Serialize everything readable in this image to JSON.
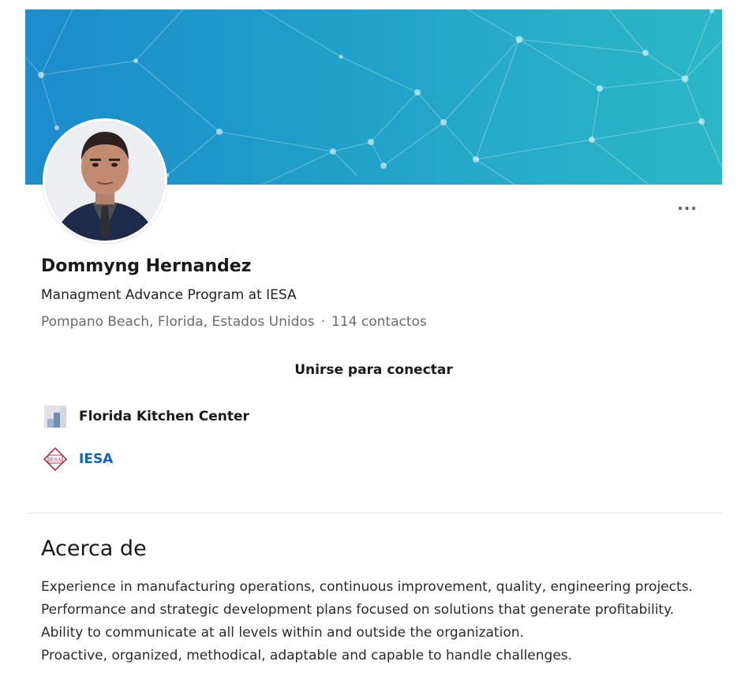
{
  "profile": {
    "name": "Dommyng Hernandez",
    "headline": "Managment Advance Program at IESA",
    "location": "Pompano Beach, Florida, Estados Unidos",
    "separator": "·",
    "connections": "114 contactos",
    "more_label": "···",
    "join_label": "Unirse para conectar"
  },
  "organizations": [
    {
      "name": "Florida Kitchen Center",
      "icon": "company-logo-icon"
    },
    {
      "name": "IESA",
      "icon": "iesa-logo-icon",
      "logo_text": "IESA"
    }
  ],
  "about": {
    "title": "Acerca de",
    "lines": [
      "Experience in manufacturing operations, continuous improvement, quality, engineering projects.",
      "Performance and strategic development plans focused on solutions that generate profitability.",
      "Ability to communicate at all levels within and outside the organization.",
      "Proactive, organized, methodical, adaptable and capable to handle challenges."
    ]
  },
  "colors": {
    "banner_start": "#1c8ccb",
    "banner_end": "#2ab7c6",
    "link_blue": "#0a66c2",
    "iesa_red": "#b0344a"
  }
}
